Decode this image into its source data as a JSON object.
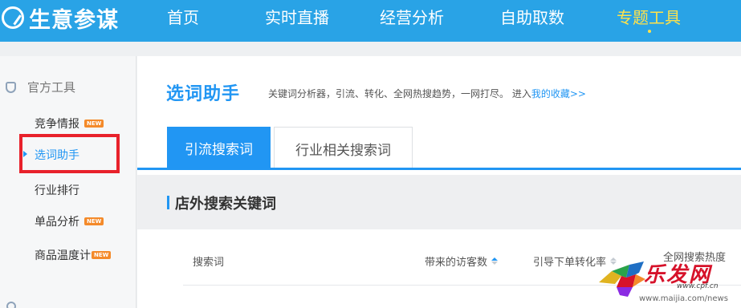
{
  "brand": {
    "name": "生意参谋"
  },
  "nav": [
    {
      "label": "首页",
      "active": false
    },
    {
      "label": "实时直播",
      "active": false
    },
    {
      "label": "经营分析",
      "active": false
    },
    {
      "label": "自助取数",
      "active": false
    },
    {
      "label": "专题工具",
      "active": true
    }
  ],
  "sidebar": {
    "section_title": "官方工具",
    "new_badge": "NEW",
    "items": [
      {
        "label": "竞争情报",
        "badge": true,
        "active": false
      },
      {
        "label": "选词助手",
        "badge": false,
        "active": true
      },
      {
        "label": "行业排行",
        "badge": false,
        "active": false
      },
      {
        "label": "单品分析",
        "badge": true,
        "active": false
      },
      {
        "label": "商品温度计",
        "badge": true,
        "active": false
      }
    ]
  },
  "page": {
    "title": "选词助手",
    "description": "关键词分析器，引流、转化、全网热搜趋势，一网打尽。 进入",
    "favorites_link": "我的收藏>>"
  },
  "tabs": [
    {
      "label": "引流搜索词",
      "active": true
    },
    {
      "label": "行业相关搜索词",
      "active": false
    }
  ],
  "section": {
    "title": "店外搜索关键词"
  },
  "table": {
    "columns": [
      {
        "label": "搜索词",
        "sortable": false
      },
      {
        "label": "带来的访客数",
        "sortable": true
      },
      {
        "label": "引导下单转化率",
        "sortable": true
      },
      {
        "label": "全网搜索热度",
        "sortable": false
      }
    ]
  },
  "watermark": {
    "title": "乐发网",
    "domain": "www.cpf.cn",
    "url": "www.maijia.com/news"
  },
  "colors": {
    "top_bar": "#29a3e6",
    "accent": "#2196f3",
    "active_nav": "#ffe24a",
    "highlight_box": "#e8212b",
    "new_badge": "#f48a2a"
  }
}
